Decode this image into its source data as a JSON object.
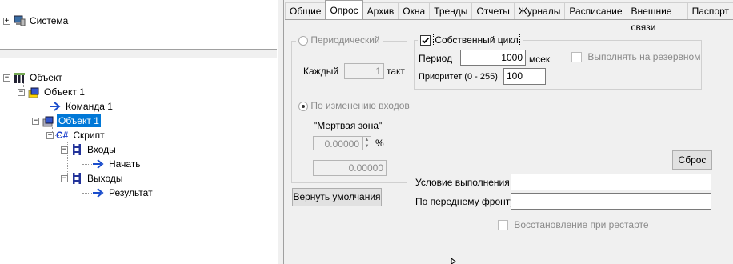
{
  "top_tree": {
    "system_label": "Система"
  },
  "tree": {
    "root": "Объект",
    "object1": "Объект 1",
    "command1": "Команда 1",
    "object1_selected": "Объект 1",
    "script": "Скрипт",
    "script_prefix": "C#",
    "inputs": "Входы",
    "start": "Начать",
    "outputs": "Выходы",
    "result": "Результат"
  },
  "tabs": [
    "Общие",
    "Опрос",
    "Архив",
    "Окна",
    "Тренды",
    "Отчеты",
    "Журналы",
    "Расписание",
    "Внешние связи",
    "Паспорт"
  ],
  "active_tab": "Опрос",
  "poll": {
    "periodic_label": "Периодический",
    "each_label": "Каждый",
    "each_value": "1",
    "tact_label": "такт",
    "on_change_label": "По изменению входов",
    "deadzone_label": "\"Мертвая зона\"",
    "deadzone_value": "0.00000",
    "deadzone_unit": "%",
    "deadzone_value2": "0.00000",
    "restore_defaults": "Вернуть умолчания"
  },
  "own_cycle": {
    "label": "Собственный цикл",
    "checked": true,
    "period_label": "Период",
    "period_value": "1000",
    "period_unit": "мсек",
    "reserve_label": "Выполнять на резервном",
    "priority_label": "Приоритет (0 - 255)",
    "priority_value": "100"
  },
  "reset_button": "Сброс",
  "condition_label": "Условие выполнения",
  "condition_value": "",
  "front_label": "По переднему фронту",
  "front_value": "",
  "restore_on_restart": "Восстановление при рестарте"
}
